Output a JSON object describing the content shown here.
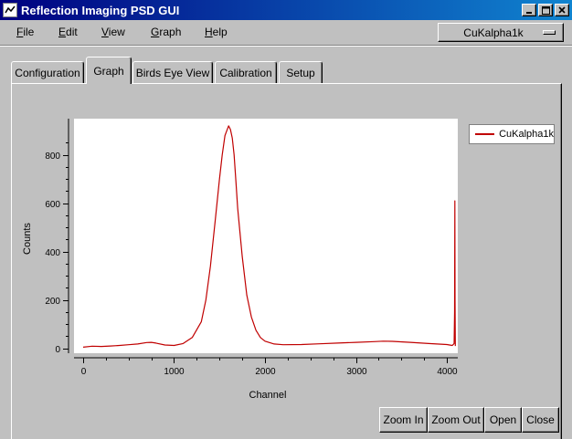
{
  "window": {
    "title": "Reflection Imaging PSD GUI"
  },
  "menu": [
    "File",
    "Edit",
    "View",
    "Graph",
    "Help"
  ],
  "profile_select": {
    "value": "CuKalpha1k"
  },
  "tabs": [
    "Configuration",
    "Graph",
    "Birds Eye View",
    "Calibration",
    "Setup"
  ],
  "active_tab": "Graph",
  "buttons": {
    "zoom_in": "Zoom In",
    "zoom_out": "Zoom Out",
    "open": "Open",
    "close": "Close"
  },
  "chart_data": {
    "type": "line",
    "xlabel": "Channel",
    "ylabel": "Counts",
    "xlim": [
      -100,
      4120
    ],
    "ylim": [
      -20,
      950
    ],
    "xticks": [
      0,
      1000,
      2000,
      3000,
      4000
    ],
    "yticks": [
      0,
      200,
      400,
      600,
      800
    ],
    "color": "#c00000",
    "grid": false,
    "legend": "outside-right-top",
    "series": [
      {
        "name": "CuKalpha1k",
        "x": [
          0,
          100,
          200,
          300,
          400,
          500,
          600,
          700,
          750,
          800,
          900,
          1000,
          1100,
          1200,
          1300,
          1350,
          1400,
          1450,
          1500,
          1530,
          1560,
          1580,
          1600,
          1620,
          1640,
          1660,
          1680,
          1700,
          1750,
          1800,
          1850,
          1900,
          1950,
          2000,
          2100,
          2200,
          2400,
          2600,
          2800,
          3000,
          3200,
          3300,
          3400,
          3600,
          3800,
          4000,
          4030,
          4060,
          4080,
          4085,
          4088,
          4090,
          4093
        ],
        "y": [
          5,
          9,
          8,
          10,
          12,
          15,
          18,
          24,
          25,
          22,
          14,
          12,
          20,
          45,
          110,
          200,
          340,
          520,
          700,
          800,
          880,
          900,
          920,
          905,
          870,
          800,
          690,
          580,
          380,
          220,
          130,
          75,
          45,
          30,
          18,
          15,
          16,
          19,
          22,
          25,
          28,
          30,
          29,
          25,
          20,
          16,
          14,
          12,
          20,
          150,
          610,
          200,
          10
        ]
      }
    ]
  }
}
